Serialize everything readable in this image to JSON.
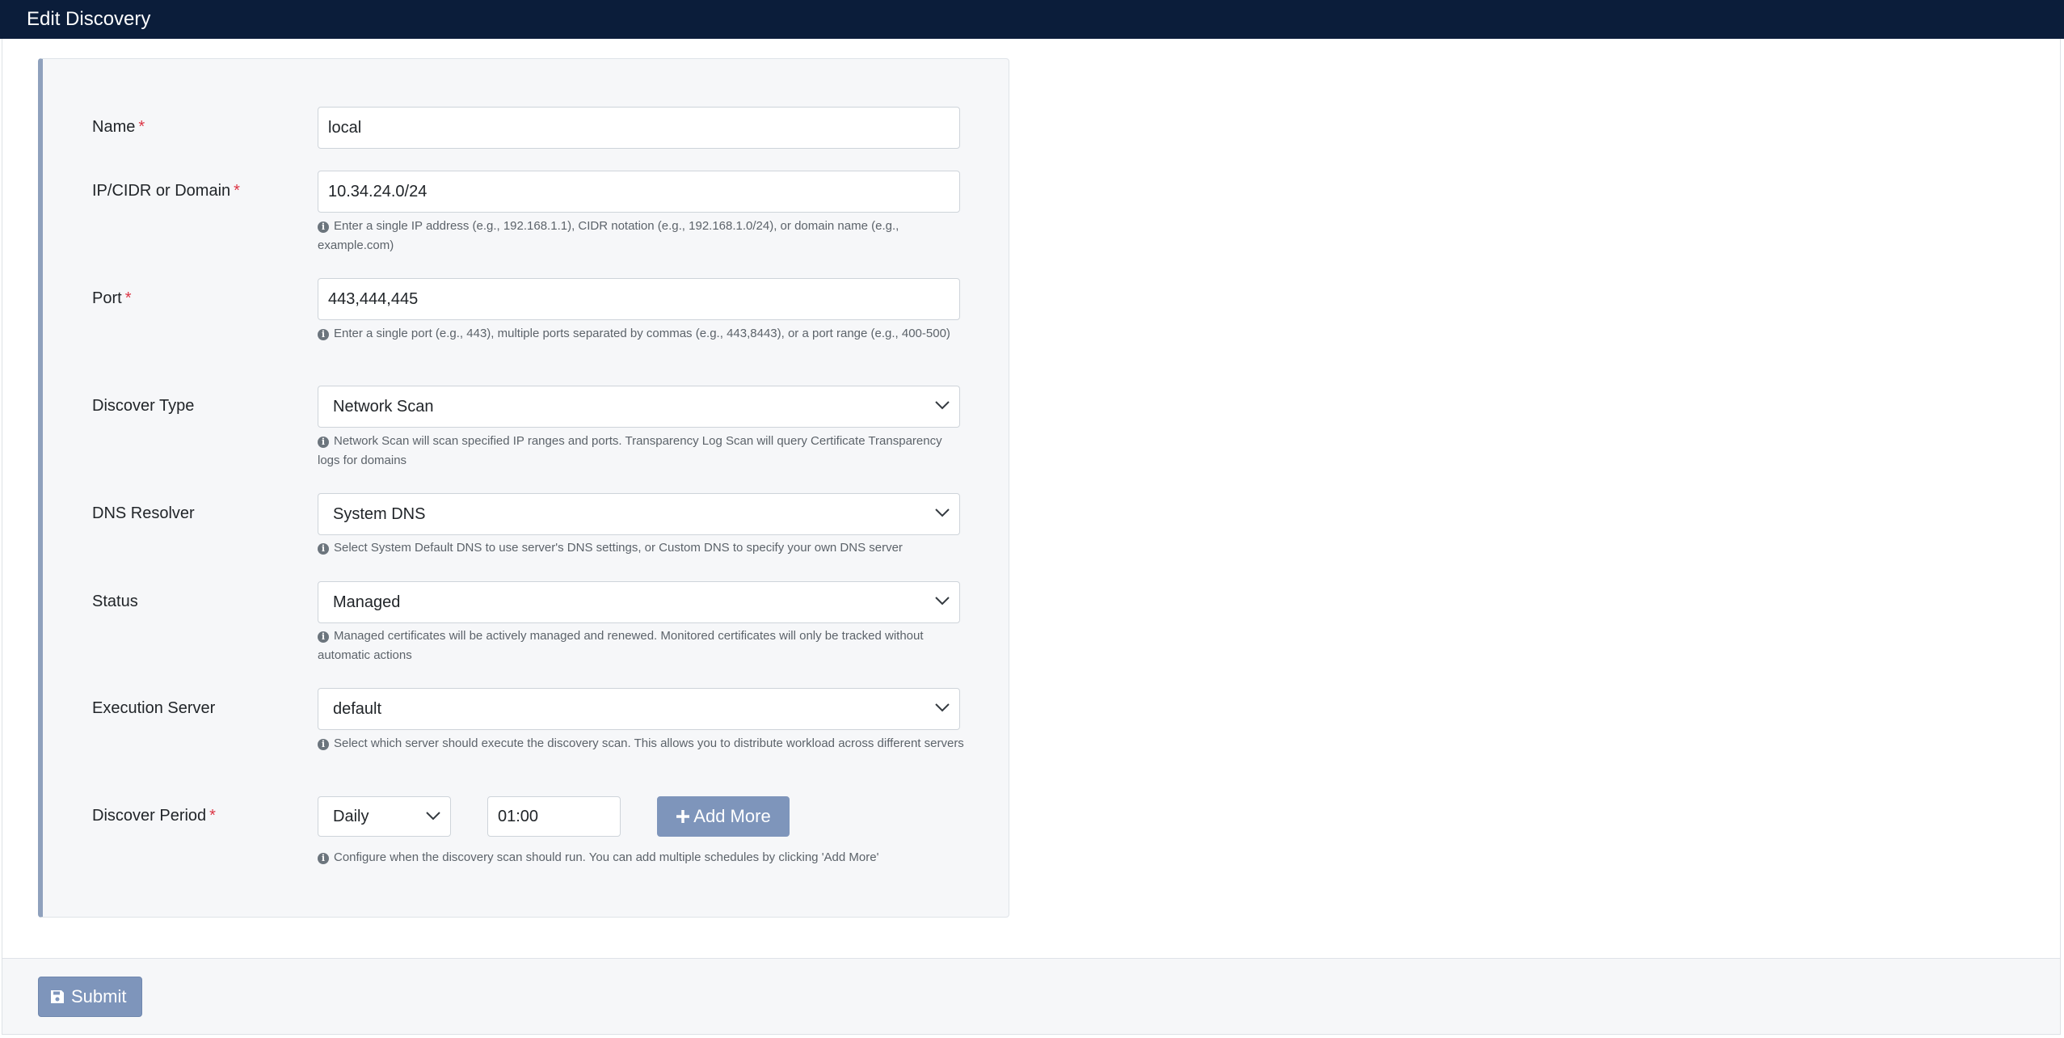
{
  "header": {
    "title": "Edit Discovery"
  },
  "form": {
    "required_mark": "*",
    "name": {
      "label": "Name",
      "value": "local"
    },
    "target": {
      "label": "IP/CIDR or Domain",
      "value": "10.34.24.0/24",
      "help": "Enter a single IP address (e.g., 192.168.1.1), CIDR notation (e.g., 192.168.1.0/24), or domain name (e.g., example.com)"
    },
    "port": {
      "label": "Port",
      "value": "443,444,445",
      "help": "Enter a single port (e.g., 443), multiple ports separated by commas (e.g., 443,8443), or a port range (e.g., 400-500)"
    },
    "discover_type": {
      "label": "Discover Type",
      "value": "Network Scan",
      "help": "Network Scan will scan specified IP ranges and ports. Transparency Log Scan will query Certificate Transparency logs for domains"
    },
    "dns_resolver": {
      "label": "DNS Resolver",
      "value": "System DNS",
      "help": "Select System Default DNS to use server's DNS settings, or Custom DNS to specify your own DNS server"
    },
    "status": {
      "label": "Status",
      "value": "Managed",
      "help": "Managed certificates will be actively managed and renewed. Monitored certificates will only be tracked without automatic actions"
    },
    "execution_server": {
      "label": "Execution Server",
      "value": "default",
      "help": "Select which server should execute the discovery scan. This allows you to distribute workload across different servers"
    },
    "discover_period": {
      "label": "Discover Period",
      "frequency": "Daily",
      "time": "01:00",
      "add_more_label": "Add More",
      "help": "Configure when the discovery scan should run. You can add multiple schedules by clicking 'Add More'"
    }
  },
  "footer": {
    "submit_label": "Submit"
  },
  "colors": {
    "header_bg": "#0b1d3a",
    "button_bg": "#7e95bb",
    "required": "#dc3545",
    "card_accent": "#8fa1bd"
  },
  "icons": {
    "info": "info-circle-icon",
    "plus": "plus-icon",
    "save": "floppy-disk-icon",
    "dropdown": "chevron-down-icon"
  }
}
